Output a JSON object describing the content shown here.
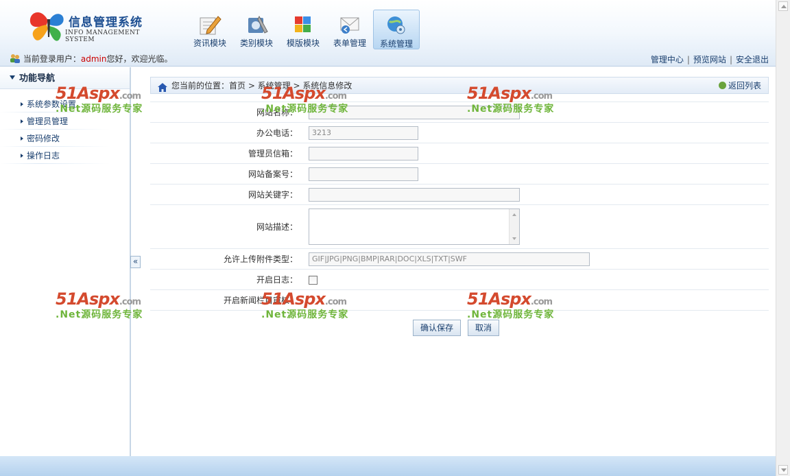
{
  "header": {
    "logo_title": "信息管理系统",
    "logo_sub": "INFO MANAGEMENT SYSTEM",
    "nav": [
      {
        "label": "资讯模块",
        "icon": "pencil-document-icon"
      },
      {
        "label": "类别模块",
        "icon": "tools-icon"
      },
      {
        "label": "模版模块",
        "icon": "puzzle-icon"
      },
      {
        "label": "表单管理",
        "icon": "mail-icon"
      },
      {
        "label": "系统管理",
        "icon": "globe-gear-icon",
        "active": true
      }
    ],
    "user_prefix": "当前登录用户：",
    "user_name": "admin",
    "user_suffix": "您好，欢迎光临。",
    "links": [
      "管理中心",
      "预览网站",
      "安全退出"
    ]
  },
  "sidebar": {
    "title": "功能导航",
    "items": [
      "系统参数设置",
      "管理员管理",
      "密码修改",
      "操作日志"
    ],
    "collapse_label": "«"
  },
  "breadcrumb": {
    "text": "您当前的位置：首页 > 系统管理 > 系统信息修改",
    "back": "返回列表"
  },
  "form": {
    "site_name": {
      "label": "网站名称：",
      "value": ""
    },
    "phone": {
      "label": "办公电话：",
      "value": "3213"
    },
    "email": {
      "label": "管理员信箱：",
      "value": ""
    },
    "icp": {
      "label": "网站备案号：",
      "value": ""
    },
    "keywords": {
      "label": "网站关键字：",
      "value": ""
    },
    "description": {
      "label": "网站描述：",
      "value": ""
    },
    "upload_types": {
      "label": "允许上传附件类型：",
      "value": "GIF|JPG|PNG|BMP|RAR|DOC|XLS|TXT|SWF"
    },
    "log": {
      "label": "开启日志：",
      "checked": false
    },
    "news_review": {
      "label": "开启新闻栏目审核：",
      "value": ""
    }
  },
  "buttons": {
    "save": "确认保存",
    "cancel": "取消"
  },
  "watermark": {
    "brand": "51Aspx",
    "dot": ".com",
    "slogan": ".Net源码服务专家"
  },
  "colors": {
    "accent": "#1a3f6e",
    "user": "#cc0000",
    "header_bottom": "#dfeaf6"
  }
}
